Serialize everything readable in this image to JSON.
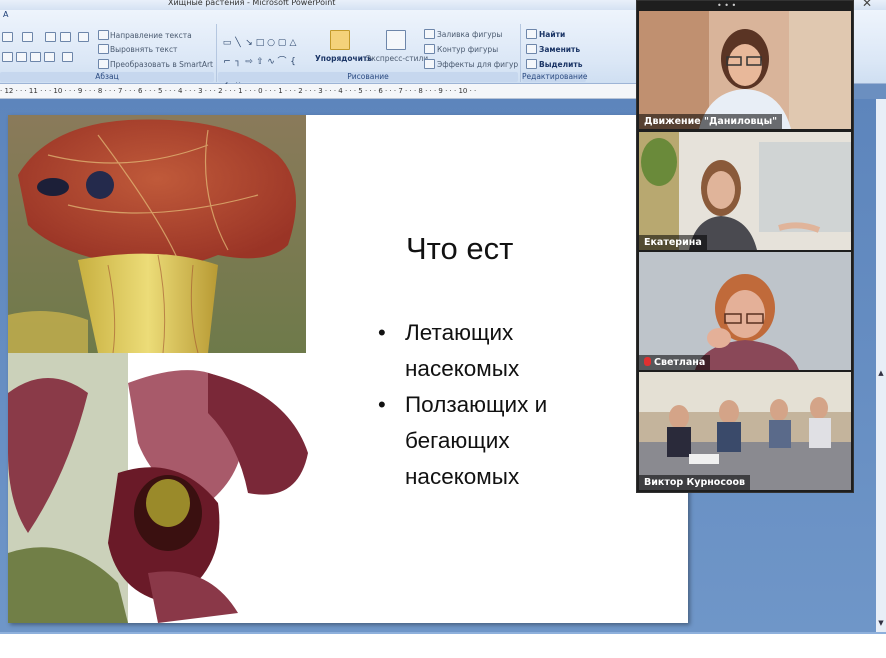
{
  "app": {
    "window_title": "Хищные растения - Microsoft PowerPoint",
    "ribbon_tab_letter": "А"
  },
  "ribbon": {
    "paragraph_group": {
      "label": "Абзац",
      "text_direction": "Направление текста",
      "align_text": "Выровнять текст",
      "convert_smartart": "Преобразовать в SmartArt"
    },
    "drawing_group": {
      "label": "Рисование",
      "arrange": "Упорядочить",
      "quick_styles": "Экспресс-стили",
      "shape_fill": "Заливка фигуры",
      "shape_outline": "Контур фигуры",
      "shape_effects": "Эффекты для фигур"
    },
    "editing_group": {
      "label": "Редактирование",
      "find": "Найти",
      "replace": "Заменить",
      "select": "Выделить"
    }
  },
  "ruler": {
    "text": "· 12 · · · 11 · · · 10 · · · 9 · · · 8 · · · 7 · · · 6 · · · 5 · · · 4 · · · 3 · · · 2 · · · 1 · · · 0 · · · 1 · · · 2 · · · 3 · · · 4 · · · 5 · · · 6 · · · 7 · · · 8 · · · 9 · · · 10 · ·"
  },
  "slide": {
    "title": "Что ест",
    "bullets": [
      {
        "text": "Летающих насекомых"
      },
      {
        "text": "Ползающих и бегающих насекомых"
      }
    ]
  },
  "video_call": {
    "participants": [
      {
        "name": "Движение \"Даниловцы\"",
        "muted": false,
        "active_speaker": false
      },
      {
        "name": "Екатерина",
        "muted": false,
        "active_speaker": true
      },
      {
        "name": "Светлана",
        "muted": true,
        "active_speaker": false
      },
      {
        "name": "Виктор Курносоов",
        "muted": false,
        "active_speaker": false
      }
    ]
  },
  "colors": {
    "workspace": "#6b8fc0",
    "active_speaker_border": "#7ecb3c",
    "muted_icon": "#e03030"
  }
}
